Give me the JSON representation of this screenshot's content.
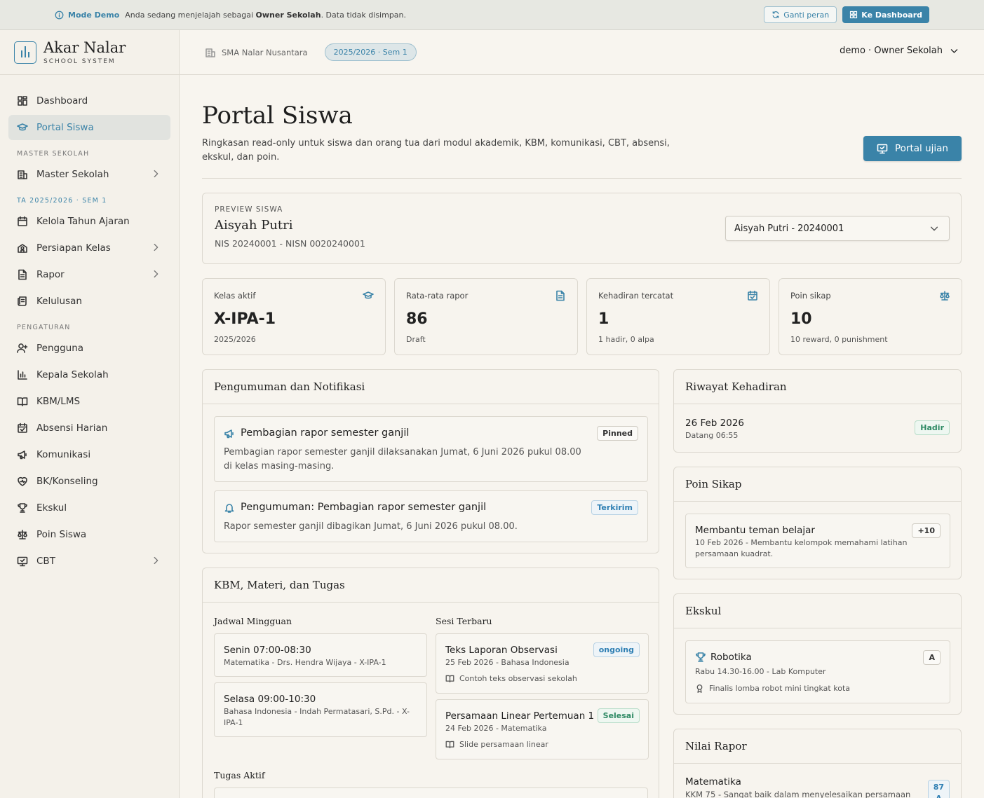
{
  "demo_bar": {
    "mode": "Mode Demo",
    "message_prefix": "Anda sedang menjelajah sebagai",
    "role": "Owner Sekolah",
    "message_suffix": ". Data tidak disimpan.",
    "switch_role": "Ganti peran",
    "to_dashboard": "Ke Dashboard"
  },
  "brand": {
    "name": "Akar Nalar",
    "sub": "SCHOOL SYSTEM"
  },
  "sidebar": {
    "top": [
      {
        "label": "Dashboard",
        "icon": "dashboard-icon"
      },
      {
        "label": "Portal Siswa",
        "icon": "graduation-cap-icon",
        "active": true
      }
    ],
    "section_master": "MASTER SEKOLAH",
    "master": [
      {
        "label": "Master Sekolah",
        "icon": "building-icon",
        "chevron": true
      }
    ],
    "section_ta": "TA 2025/2026 · SEM 1",
    "ta": [
      {
        "label": "Kelola Tahun Ajaran",
        "icon": "calendar-icon"
      },
      {
        "label": "Persiapan Kelas",
        "icon": "school-icon",
        "chevron": true
      },
      {
        "label": "Rapor",
        "icon": "file-icon",
        "chevron": true
      },
      {
        "label": "Kelulusan",
        "icon": "scroll-icon"
      }
    ],
    "section_settings": "PENGATURAN",
    "settings": [
      {
        "label": "Pengguna",
        "icon": "user-plus-icon"
      },
      {
        "label": "Kepala Sekolah",
        "icon": "chart-icon"
      },
      {
        "label": "KBM/LMS",
        "icon": "book-icon"
      },
      {
        "label": "Absensi Harian",
        "icon": "calendar-check-icon"
      },
      {
        "label": "Komunikasi",
        "icon": "megaphone-icon"
      },
      {
        "label": "BK/Konseling",
        "icon": "heart-icon"
      },
      {
        "label": "Ekskul",
        "icon": "trophy-icon"
      },
      {
        "label": "Poin Siswa",
        "icon": "scale-icon"
      },
      {
        "label": "CBT",
        "icon": "monitor-icon",
        "chevron": true
      }
    ]
  },
  "topbar": {
    "school": "SMA Nalar Nusantara",
    "term": "2025/2026 · Sem 1",
    "user": "demo · Owner Sekolah"
  },
  "page": {
    "title": "Portal Siswa",
    "description": "Ringkasan read-only untuk siswa dan orang tua dari modul akademik, KBM, komunikasi, CBT, absensi, ekskul, dan poin.",
    "exam_button": "Portal ujian"
  },
  "preview": {
    "caption": "PREVIEW SISWA",
    "name": "Aisyah Putri",
    "ids": "NIS 20240001 - NISN 0020240001",
    "selected": "Aisyah Putri - 20240001"
  },
  "stats": [
    {
      "label": "Kelas aktif",
      "value": "X-IPA-1",
      "sub": "2025/2026",
      "icon": "graduation-cap-icon"
    },
    {
      "label": "Rata-rata rapor",
      "value": "86",
      "sub": "Draft",
      "icon": "file-icon"
    },
    {
      "label": "Kehadiran tercatat",
      "value": "1",
      "sub": "1 hadir, 0 alpa",
      "icon": "calendar-check-icon"
    },
    {
      "label": "Poin sikap",
      "value": "10",
      "sub": "10 reward, 0 punishment",
      "icon": "scale-icon"
    }
  ],
  "announcements": {
    "title": "Pengumuman dan Notifikasi",
    "items": [
      {
        "title": "Pembagian rapor semester ganjil",
        "body": "Pembagian rapor semester ganjil dilaksanakan Jumat, 6 Juni 2026 pukul 08.00 di kelas masing-masing.",
        "badge": "Pinned",
        "icon": "megaphone-icon"
      },
      {
        "title": "Pengumuman: Pembagian rapor semester ganjil",
        "body": "Rapor semester ganjil dibagikan Jumat, 6 Juni 2026 pukul 08.00.",
        "badge": "Terkirim",
        "icon": "bell-icon"
      }
    ]
  },
  "kbm": {
    "title": "KBM, Materi, dan Tugas",
    "schedule_title": "Jadwal Mingguan",
    "schedule": [
      {
        "time": "Senin 07:00-08:30",
        "detail": "Matematika - Drs. Hendra Wijaya - X-IPA-1"
      },
      {
        "time": "Selasa 09:00-10:30",
        "detail": "Bahasa Indonesia - Indah Permatasari, S.Pd. - X-IPA-1"
      }
    ],
    "sessions_title": "Sesi Terbaru",
    "sessions": [
      {
        "title": "Teks Laporan Observasi",
        "meta": "25 Feb 2026 - Bahasa Indonesia",
        "material": "Contoh teks observasi sekolah",
        "badge": "ongoing"
      },
      {
        "title": "Persamaan Linear Pertemuan 1",
        "meta": "24 Feb 2026 - Matematika",
        "material": "Slide persamaan linear",
        "badge": "Selesai"
      }
    ],
    "tasks_title": "Tugas Aktif"
  },
  "attendance": {
    "title": "Riwayat Kehadiran",
    "date": "26 Feb 2026",
    "arrival": "Datang 06:55",
    "status": "Hadir"
  },
  "points": {
    "title": "Poin Sikap",
    "item": "Membantu teman belajar",
    "detail": "10 Feb 2026 - Membantu kelompok memahami latihan persamaan kuadrat.",
    "value": "+10"
  },
  "ekskul": {
    "title": "Ekskul",
    "name": "Robotika",
    "schedule": "Rabu 14.30-16.00 - Lab Komputer",
    "achievement": "Finalis lomba robot mini tingkat kota",
    "grade": "A"
  },
  "grades": {
    "title": "Nilai Rapor",
    "subject": "Matematika",
    "note": "KKM 75 - Sangat baik dalam menyelesaikan persamaan",
    "score": "87",
    "letter": "A"
  },
  "colors": {
    "accent": "#3a83a8",
    "background": "#f8f5ef",
    "sidebar": "#f4f1ea"
  }
}
